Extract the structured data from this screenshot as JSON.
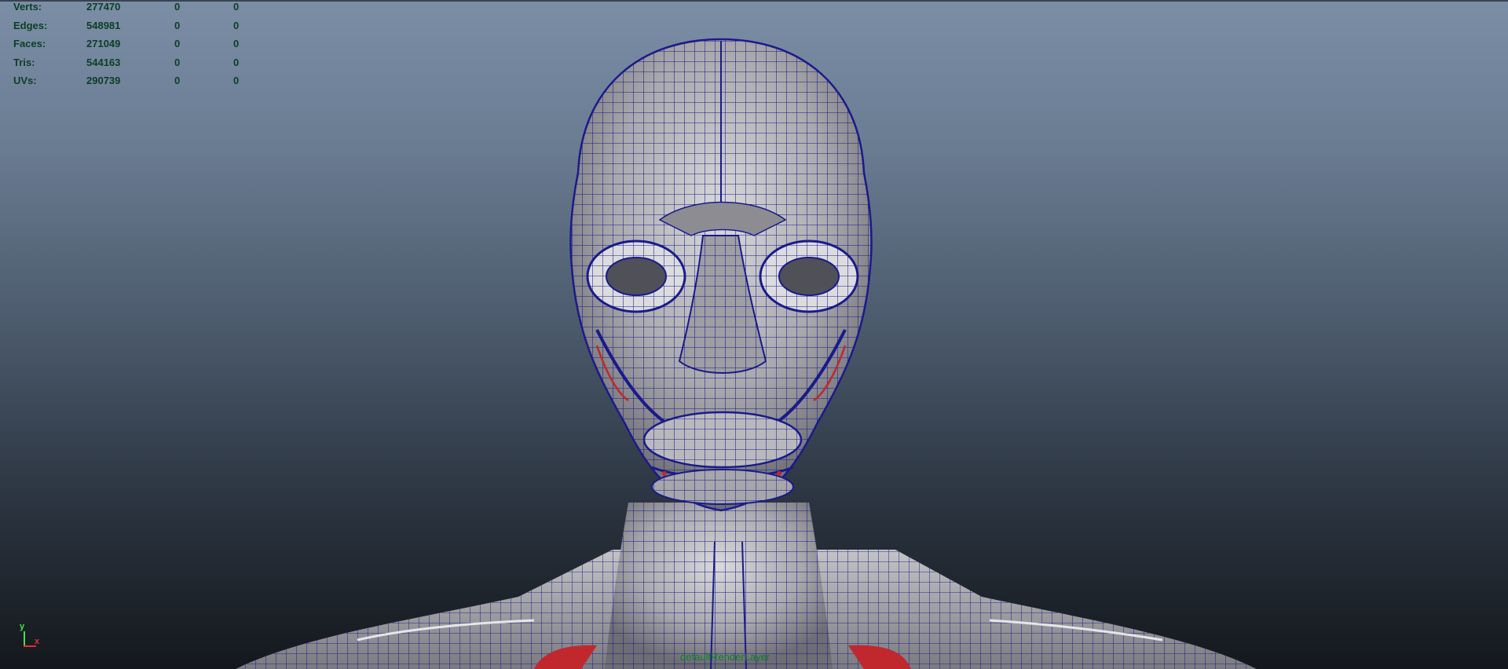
{
  "app": "Maya viewport",
  "hud": {
    "rows": [
      {
        "label": "Verts:",
        "value": "277470",
        "c1": "0",
        "c2": "0"
      },
      {
        "label": "Edges:",
        "value": "548981",
        "c1": "0",
        "c2": "0"
      },
      {
        "label": "Faces:",
        "value": "271049",
        "c1": "0",
        "c2": "0"
      },
      {
        "label": "Tris:",
        "value": "544163",
        "c1": "0",
        "c2": "0"
      },
      {
        "label": "UVs:",
        "value": "290739",
        "c1": "0",
        "c2": "0"
      }
    ],
    "text_color": "#0b3f24"
  },
  "axis": {
    "y": "y",
    "x": "x",
    "y_color": "#47e04a",
    "x_color": "#e03030"
  },
  "render_layer": "defaultRenderLayer",
  "model": {
    "wire_color": "#1a1a8c",
    "surface_color": "#b5b5b8",
    "muscle_color": "#c0282e"
  }
}
